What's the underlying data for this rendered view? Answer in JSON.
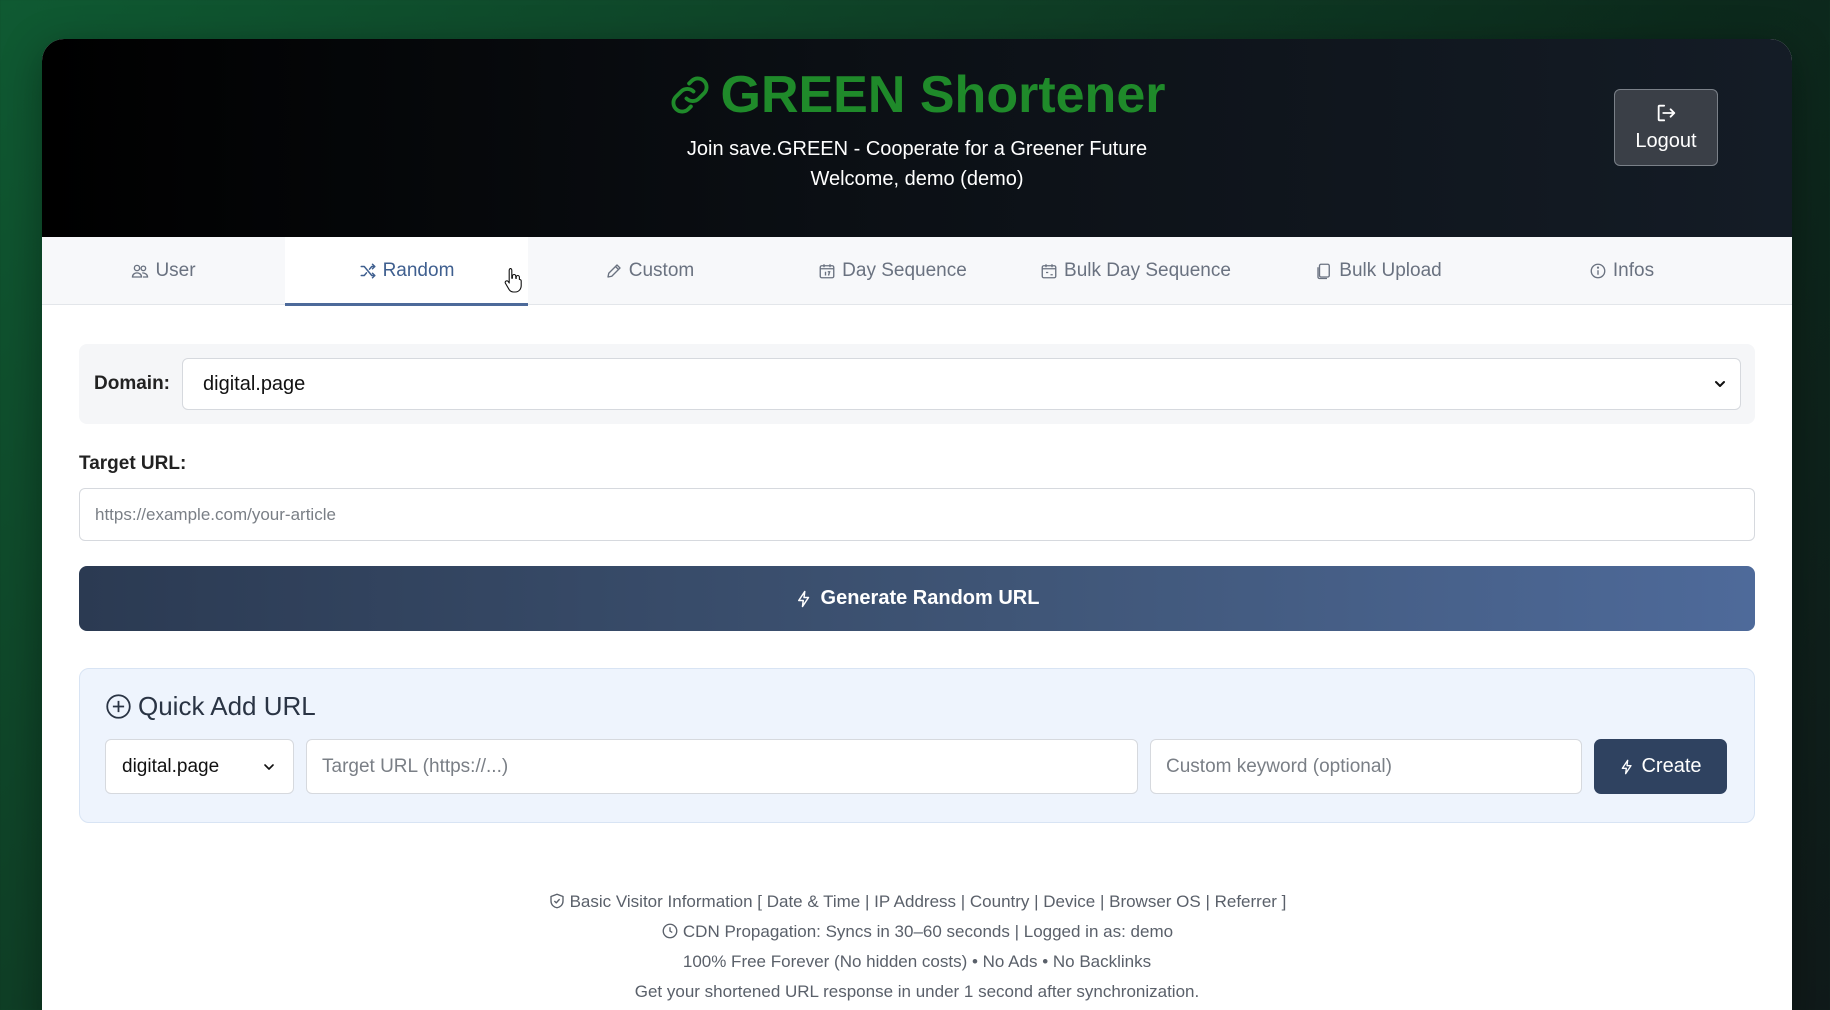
{
  "header": {
    "title": "GREEN Shortener",
    "tagline": "Join save.GREEN - Cooperate for a Greener Future",
    "welcome": "Welcome, demo (demo)",
    "logout_label": "Logout",
    "brand_color": "#1f8a2a"
  },
  "tabs": [
    {
      "label": "User",
      "icon": "users-icon"
    },
    {
      "label": "Random",
      "icon": "shuffle-icon",
      "active": true
    },
    {
      "label": "Custom",
      "icon": "pencil-icon"
    },
    {
      "label": "Day Sequence",
      "icon": "calendar-day-icon"
    },
    {
      "label": "Bulk Day Sequence",
      "icon": "calendar-range-icon"
    },
    {
      "label": "Bulk Upload",
      "icon": "files-icon"
    },
    {
      "label": "Infos",
      "icon": "info-icon"
    }
  ],
  "form": {
    "domain_label": "Domain:",
    "domain_value": "digital.page",
    "target_label": "Target URL:",
    "target_placeholder": "https://example.com/your-article",
    "generate_label": "Generate Random URL"
  },
  "quick_add": {
    "title": "Quick Add URL",
    "domain_value": "digital.page",
    "url_placeholder": "Target URL (https://...)",
    "keyword_placeholder": "Custom keyword (optional)",
    "create_label": "Create"
  },
  "footer": {
    "line1": "Basic Visitor Information [ Date & Time | IP Address | Country | Device | Browser OS | Referrer ]",
    "line2": "CDN Propagation: Syncs in 30–60 seconds | Logged in as: demo",
    "line3": "100% Free Forever (No hidden costs) • No Ads • No Backlinks",
    "line4": "Get your shortened URL response in under 1 second after synchronization."
  }
}
